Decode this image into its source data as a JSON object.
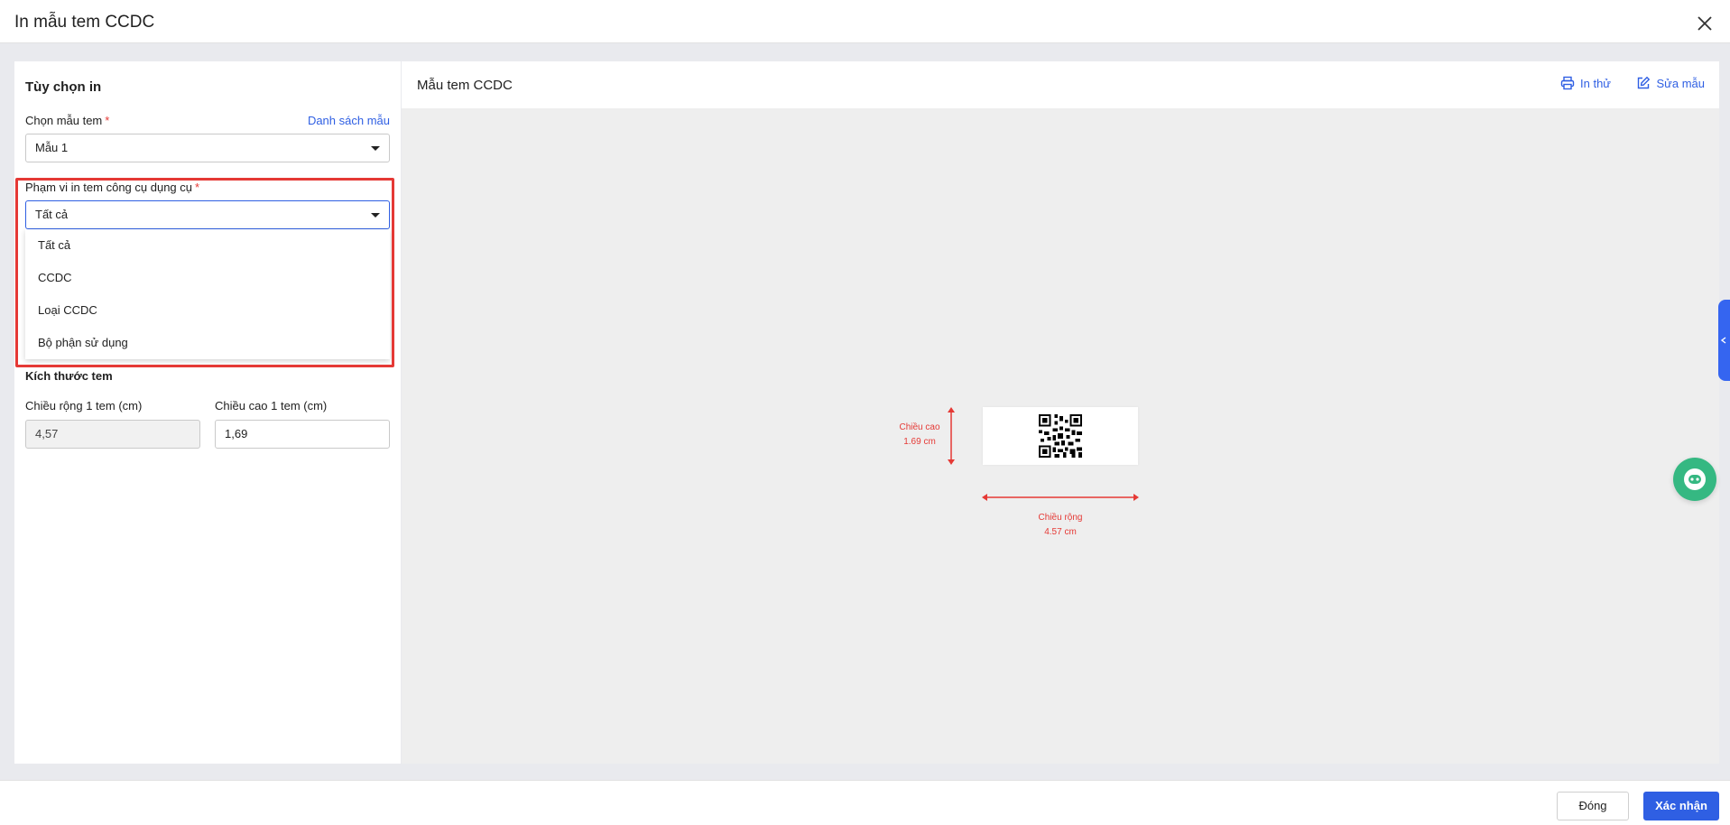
{
  "dialog": {
    "title": "In mẫu tem CCDC"
  },
  "options": {
    "title": "Tùy chọn in",
    "template_label": "Chọn mẫu tem",
    "template_list_link": "Danh sách mẫu",
    "template_value": "Mẫu 1",
    "scope_label": "Phạm vi in tem công cụ dụng cụ",
    "scope_value": "Tất cả",
    "scope_options": [
      "Tất cả",
      "CCDC",
      "Loại CCDC",
      "Bộ phận sử dụng"
    ],
    "size_title": "Kích thước tem",
    "width_label": "Chiều rộng 1 tem (cm)",
    "width_value": "4,57",
    "height_label": "Chiều cao 1 tem (cm)",
    "height_value": "1,69",
    "required_mark": "*"
  },
  "preview": {
    "title": "Mẫu tem CCDC",
    "print_test": "In thử",
    "edit_template": "Sửa mẫu",
    "height_dim_label": "Chiều cao",
    "height_dim_value": "1.69 cm",
    "width_dim_label": "Chiều rộng",
    "width_dim_value": "4.57 cm"
  },
  "footer": {
    "close": "Đóng",
    "confirm": "Xác nhận"
  },
  "colors": {
    "accent": "#2f5fe3",
    "highlight": "#e53935",
    "chat": "#35b882"
  }
}
